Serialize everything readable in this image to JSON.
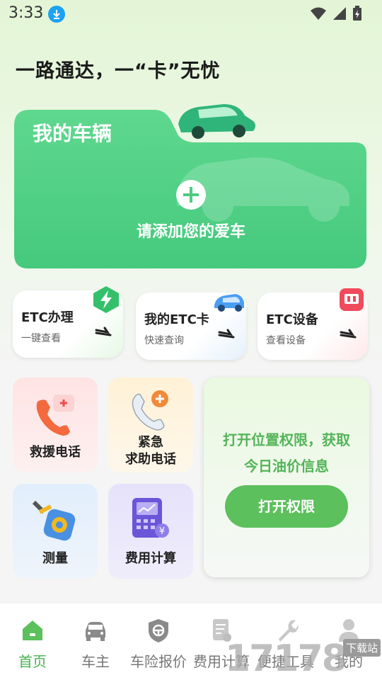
{
  "status": {
    "time": "3:33"
  },
  "slogan": "一路通达，一“卡”无忧",
  "vehicle": {
    "title": "我的车辆",
    "add_text": "请添加您的爱车"
  },
  "etc_cards": [
    {
      "title": "ETC办理",
      "subtitle": "一键查看",
      "icon": "lightning-icon"
    },
    {
      "title": "我的ETC卡",
      "subtitle": "快速查询",
      "icon": "car-icon"
    },
    {
      "title": "ETC设备",
      "subtitle": "查看设备",
      "icon": "device-icon"
    }
  ],
  "services": [
    {
      "label": "救援电话",
      "icon": "phone-icon"
    },
    {
      "label1": "紧急",
      "label2": "求助电话",
      "icon": "emergency-phone-icon"
    },
    {
      "label": "测量",
      "icon": "tape-measure-icon"
    },
    {
      "label": "费用计算",
      "icon": "calculator-icon"
    }
  ],
  "location": {
    "line1": "打开位置权限，获取",
    "line2": "今日油价信息",
    "button": "打开权限"
  },
  "tabs": [
    {
      "label": "首页",
      "icon": "home-icon",
      "active": true
    },
    {
      "label": "车主",
      "icon": "car-owner-icon"
    },
    {
      "label": "车险报价",
      "icon": "insurance-shield-icon"
    },
    {
      "label": "费用计算",
      "icon": "document-icon"
    },
    {
      "label": "便捷工具",
      "icon": "wrench-icon"
    },
    {
      "label": "我的",
      "icon": "user-icon"
    }
  ],
  "watermark": {
    "text": "17178",
    "badge": "下载站"
  },
  "colors": {
    "accent": "#46b34b",
    "card_green": "#4fcb82"
  }
}
